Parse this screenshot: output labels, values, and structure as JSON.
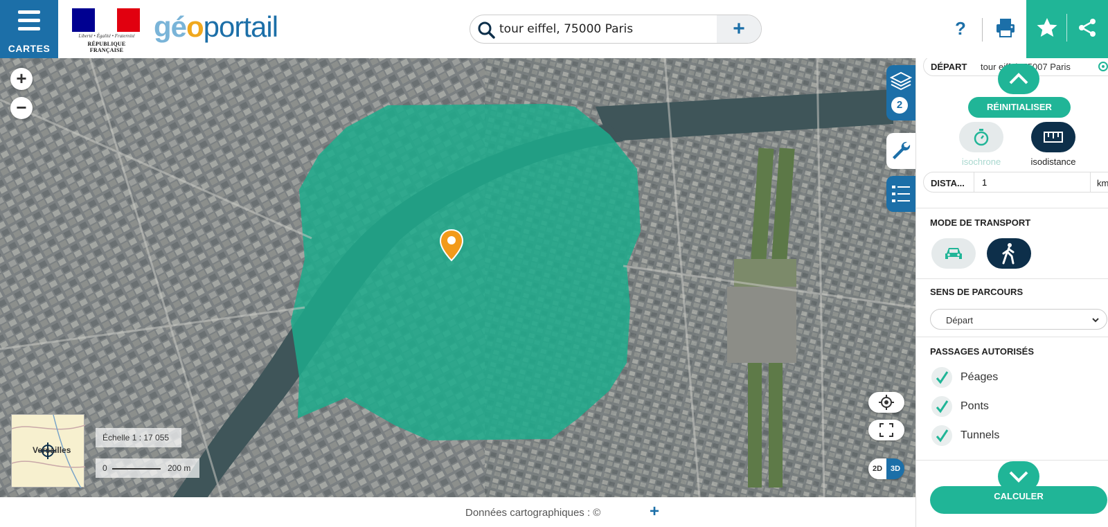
{
  "header": {
    "menu_label": "CARTES",
    "motto": "Liberté • Égalité • Fraternité",
    "republic": "RÉPUBLIQUE FRANÇAISE",
    "brand_part1": "gé",
    "brand_part2": "o",
    "brand_part3": "portail",
    "search_value": "tour eiffel, 75000 Paris",
    "help_label": "?"
  },
  "colors": {
    "accent": "#20b597",
    "brand_blue": "#1c6fa8",
    "dark_navy": "#0d2f4a",
    "isochrone_fill": "#1dab8c"
  },
  "map": {
    "layers_count": "2",
    "overview_label": "Versailles",
    "scale_text": "Échelle 1 : 17 055",
    "scale_zero": "0",
    "scale_distance": "200 m",
    "toggle_2d": "2D",
    "toggle_3d": "3D"
  },
  "footer": {
    "credit": "Données cartographiques : ©"
  },
  "panel": {
    "depart_label": "DÉPART",
    "depart_value": "tour eiffel, 75007 Paris",
    "reset_label": "RÉINITIALISER",
    "isochrone_label": "isochrone",
    "isodistance_label": "isodistance",
    "distance_label": "DISTA...",
    "distance_value": "1",
    "distance_unit": "km",
    "transport_title": "MODE DE TRANSPORT",
    "sens_title": "SENS DE PARCOURS",
    "sens_value": "Départ",
    "passages_title": "PASSAGES AUTORISÉS",
    "passages": [
      "Péages",
      "Ponts",
      "Tunnels"
    ],
    "calc_label": "CALCULER"
  },
  "icons": [
    "menu-icon",
    "search-icon",
    "plus-icon",
    "help-icon",
    "print-icon",
    "star-icon",
    "share-icon",
    "layers-icon",
    "wrench-icon",
    "list-icon",
    "locate-icon",
    "fullscreen-icon",
    "map-marker-icon",
    "chevron-up-icon",
    "chevron-down-icon",
    "stopwatch-icon",
    "ruler-icon",
    "car-icon",
    "walk-icon",
    "check-icon"
  ]
}
